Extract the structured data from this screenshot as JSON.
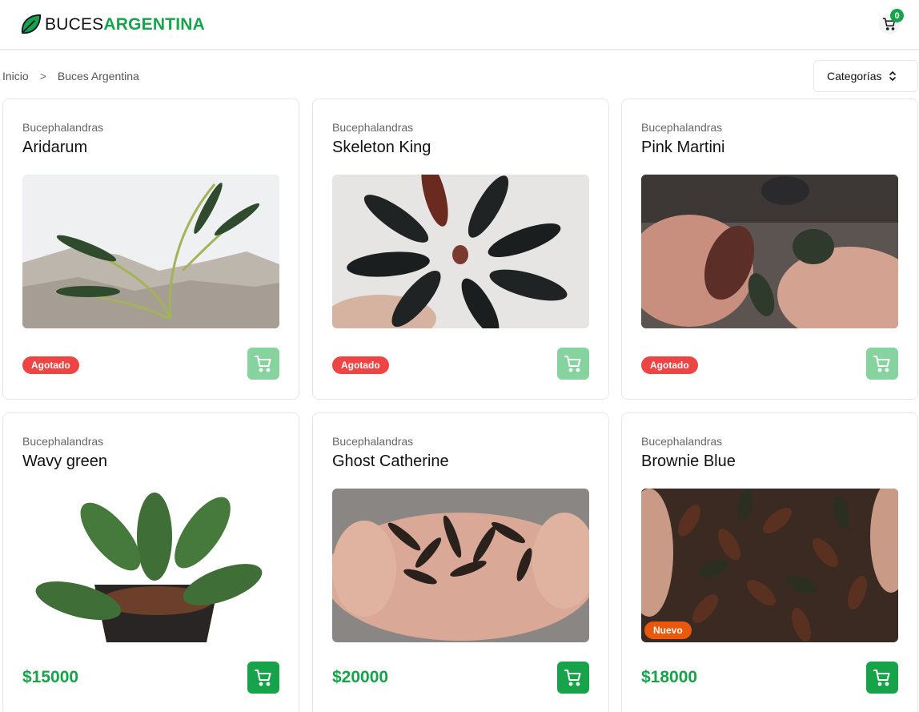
{
  "header": {
    "logo_part1": "BUCES",
    "logo_part2": "ARGENTINA",
    "cart_count": "0"
  },
  "breadcrumb": {
    "items": [
      "Inicio",
      "Buces Argentina"
    ],
    "separator": ">"
  },
  "filters": {
    "categories_label": "Categorías"
  },
  "colors": {
    "accent": "#16a34a",
    "out_of_stock": "#ef4444",
    "new_badge": "#ea580c"
  },
  "products": [
    {
      "category": "Bucephalandras",
      "name": "Aridarum",
      "status": "Agotado",
      "price": null
    },
    {
      "category": "Bucephalandras",
      "name": "Skeleton King",
      "status": "Agotado",
      "price": null
    },
    {
      "category": "Bucephalandras",
      "name": "Pink Martini",
      "status": "Agotado",
      "price": null
    },
    {
      "category": "Bucephalandras",
      "name": "Wavy green",
      "status": null,
      "price": "$15000"
    },
    {
      "category": "Bucephalandras",
      "name": "Ghost Catherine",
      "status": null,
      "price": "$20000"
    },
    {
      "category": "Bucephalandras",
      "name": "Brownie Blue",
      "status": null,
      "price": "$18000",
      "image_badge": "Nuevo"
    }
  ]
}
